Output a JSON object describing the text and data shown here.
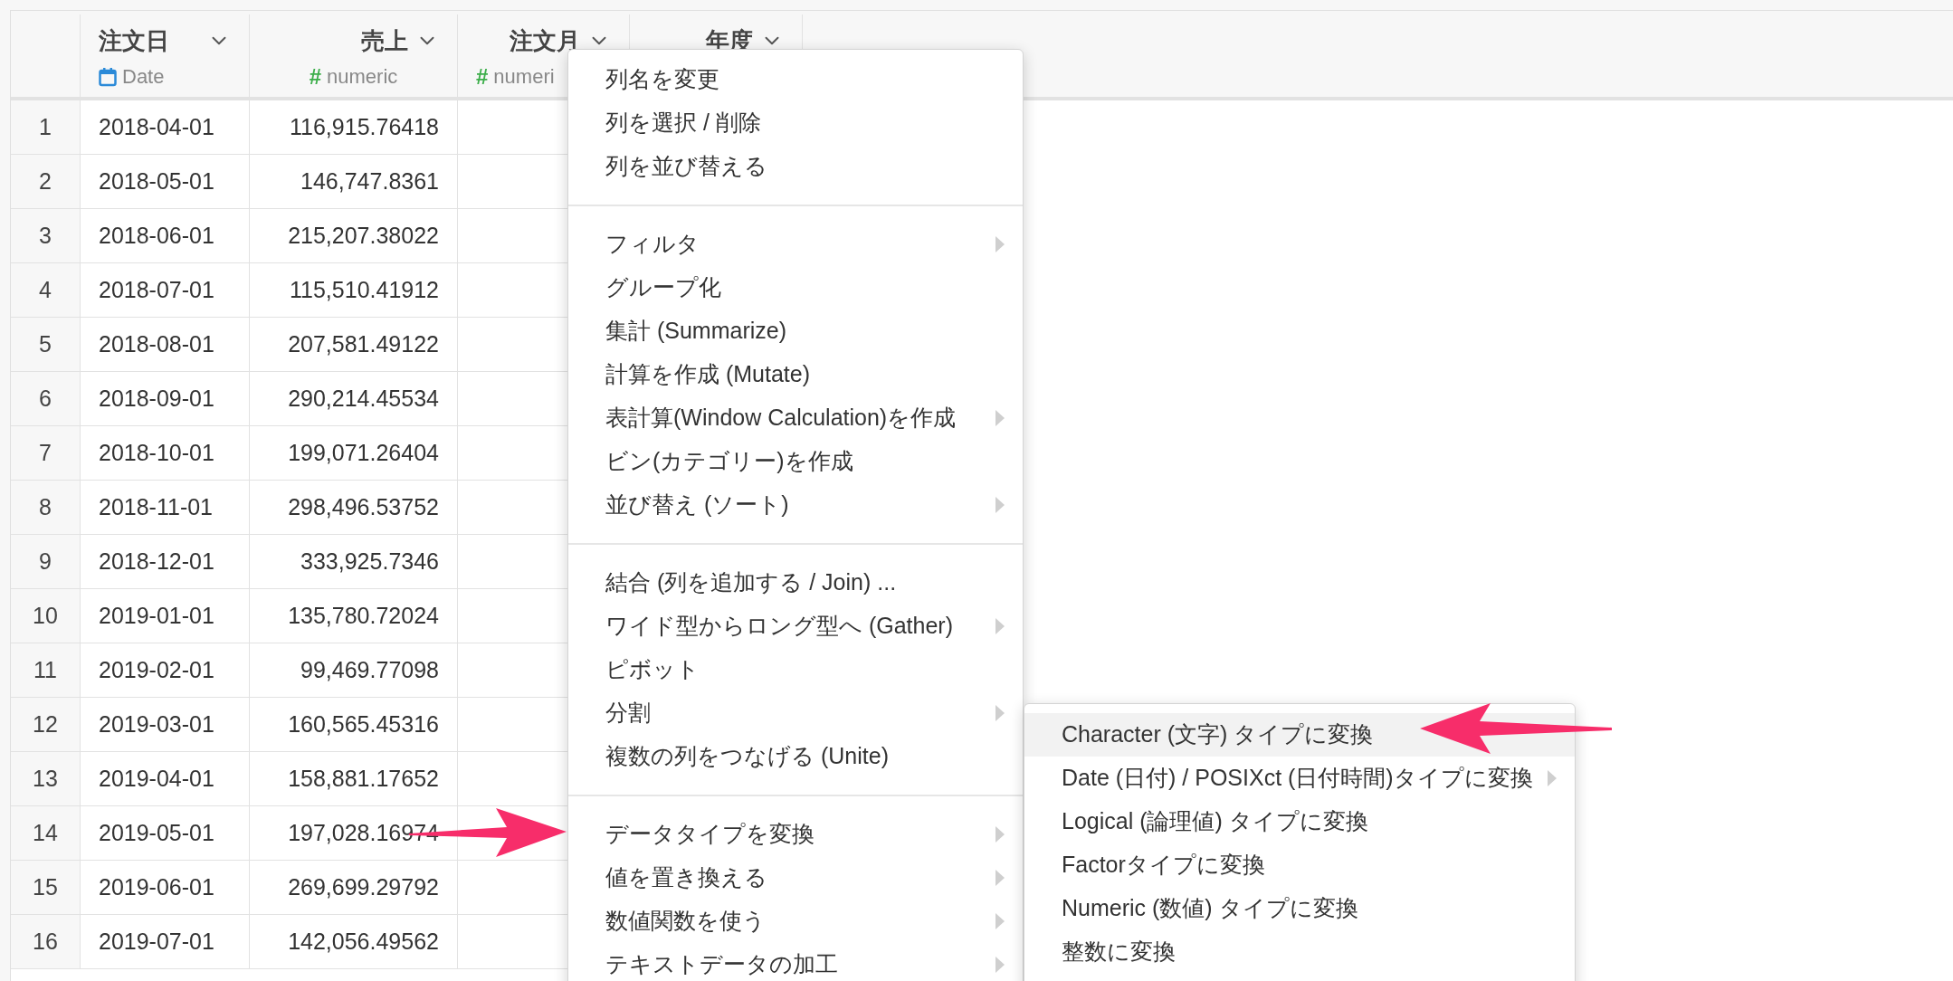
{
  "table": {
    "columns": [
      {
        "title": "注文日",
        "type": {
          "kind": "date",
          "label": "Date"
        }
      },
      {
        "title": "売上",
        "type": {
          "kind": "numeric",
          "symbol": "#",
          "label": "numeric"
        }
      },
      {
        "title": "注文月",
        "type": {
          "kind": "numeric",
          "symbol": "#",
          "label": "numeri"
        }
      },
      {
        "title": "年度"
      }
    ],
    "rows": [
      {
        "number": "1",
        "cells": [
          "2018-04-01",
          "116,915.76418"
        ]
      },
      {
        "number": "2",
        "cells": [
          "2018-05-01",
          "146,747.8361"
        ]
      },
      {
        "number": "3",
        "cells": [
          "2018-06-01",
          "215,207.38022"
        ]
      },
      {
        "number": "4",
        "cells": [
          "2018-07-01",
          "115,510.41912"
        ]
      },
      {
        "number": "5",
        "cells": [
          "2018-08-01",
          "207,581.49122"
        ]
      },
      {
        "number": "6",
        "cells": [
          "2018-09-01",
          "290,214.45534"
        ]
      },
      {
        "number": "7",
        "cells": [
          "2018-10-01",
          "199,071.26404"
        ]
      },
      {
        "number": "8",
        "cells": [
          "2018-11-01",
          "298,496.53752"
        ]
      },
      {
        "number": "9",
        "cells": [
          "2018-12-01",
          "333,925.7346"
        ]
      },
      {
        "number": "10",
        "cells": [
          "2019-01-01",
          "135,780.72024"
        ]
      },
      {
        "number": "11",
        "cells": [
          "2019-02-01",
          "99,469.77098"
        ]
      },
      {
        "number": "12",
        "cells": [
          "2019-03-01",
          "160,565.45316"
        ]
      },
      {
        "number": "13",
        "cells": [
          "2019-04-01",
          "158,881.17652"
        ]
      },
      {
        "number": "14",
        "cells": [
          "2019-05-01",
          "197,028.16974"
        ]
      },
      {
        "number": "15",
        "cells": [
          "2019-06-01",
          "269,699.29792"
        ]
      },
      {
        "number": "16",
        "cells": [
          "2019-07-01",
          "142,056.49562"
        ]
      }
    ]
  },
  "menu": {
    "groups": [
      [
        {
          "label": "列名を変更",
          "submenu": false
        },
        {
          "label": "列を選択 / 削除",
          "submenu": false
        },
        {
          "label": "列を並び替える",
          "submenu": false
        }
      ],
      [
        {
          "label": "フィルタ",
          "submenu": true
        },
        {
          "label": "グループ化",
          "submenu": false
        },
        {
          "label": "集計 (Summarize)",
          "submenu": false
        },
        {
          "label": "計算を作成 (Mutate)",
          "submenu": false
        },
        {
          "label": "表計算(Window Calculation)を作成",
          "submenu": true
        },
        {
          "label": "ビン(カテゴリー)を作成",
          "submenu": false
        },
        {
          "label": "並び替え (ソート)",
          "submenu": true
        }
      ],
      [
        {
          "label": "結合 (列を追加する / Join) ...",
          "submenu": false
        },
        {
          "label": "ワイド型からロング型へ (Gather)",
          "submenu": true
        },
        {
          "label": "ピボット",
          "submenu": false
        },
        {
          "label": "分割",
          "submenu": true
        },
        {
          "label": "複数の列をつなげる (Unite)",
          "submenu": false
        }
      ],
      [
        {
          "label": "データタイプを変換",
          "submenu": true
        },
        {
          "label": "値を置き換える",
          "submenu": true
        },
        {
          "label": "数値関数を使う",
          "submenu": true
        },
        {
          "label": "テキストデータの加工",
          "submenu": true
        }
      ]
    ]
  },
  "submenu": {
    "items": [
      {
        "label": "Character (文字) タイプに変換",
        "submenu": false,
        "selected": true
      },
      {
        "label": "Date (日付) / POSIXct (日付時間)タイプに変換",
        "submenu": true,
        "selected": false
      },
      {
        "label": "Logical (論理値) タイプに変換",
        "submenu": false,
        "selected": false
      },
      {
        "label": "Factorタイプに変換",
        "submenu": false,
        "selected": false
      },
      {
        "label": "Numeric (数値) タイプに変換",
        "submenu": false,
        "selected": false
      },
      {
        "label": "整数に変換",
        "submenu": false,
        "selected": false
      }
    ]
  }
}
